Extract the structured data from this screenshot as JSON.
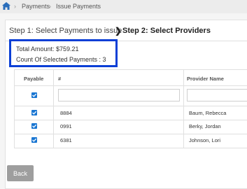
{
  "breadcrumb": {
    "home_icon": "home-icon",
    "items": [
      "Payments",
      "Issue Payments"
    ],
    "separator": "›"
  },
  "steps": {
    "step1": "Step 1: Select Payments to issue",
    "step2": "Step 2: Select Providers",
    "chevron": "❯"
  },
  "summary": {
    "total": "Total Amount: $759.21",
    "count": "Count Of Selected Payments : 3"
  },
  "table": {
    "headers": [
      "Payable",
      "#",
      "Provider Name"
    ],
    "rows": [
      {
        "payable": true,
        "number": "8884",
        "provider": "Baum, Rebecca"
      },
      {
        "payable": true,
        "number": "0991",
        "provider": "Berky, Jordan"
      },
      {
        "payable": true,
        "number": "6381",
        "provider": "Johnson, Lori"
      }
    ],
    "select_all_checked": true
  },
  "buttons": {
    "back": "Back"
  },
  "colors": {
    "highlight_border": "#0b3fd6",
    "checkbox": "#1976d2",
    "back_button": "#9e9e9e"
  }
}
